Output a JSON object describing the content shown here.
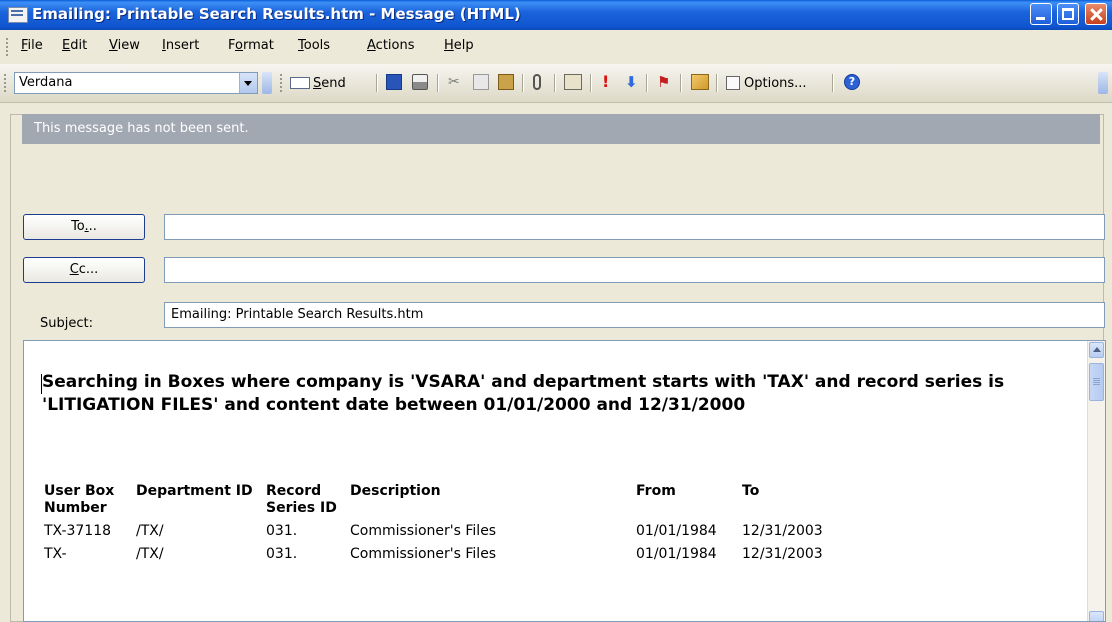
{
  "window": {
    "title": "Emailing: Printable Search Results.htm - Message (HTML)"
  },
  "menu": [
    {
      "label": "File",
      "ul": "F"
    },
    {
      "label": "Edit",
      "ul": "E"
    },
    {
      "label": "View",
      "ul": "V"
    },
    {
      "label": "Insert",
      "ul": "I"
    },
    {
      "label": "Format",
      "ul": "o"
    },
    {
      "label": "Tools",
      "ul": "T"
    },
    {
      "label": "Actions",
      "ul": "A"
    },
    {
      "label": "Help",
      "ul": "H"
    }
  ],
  "toolbar": {
    "font_name": "Verdana",
    "send_label": "Send",
    "options_label": "Options...",
    "icons": [
      "save-icon",
      "print-icon",
      "cut-icon",
      "copy-icon",
      "paste-icon",
      "attach-icon",
      "address-book-icon",
      "high-importance-icon",
      "low-importance-icon",
      "flag-icon",
      "permission-icon",
      "options-icon",
      "help-icon"
    ]
  },
  "message": {
    "status_banner": "This message has not been sent.",
    "to_button": "To...",
    "cc_button": "Cc...",
    "to_value": "",
    "cc_value": "",
    "subject_label": "Subject:",
    "subject_value": "Emailing: Printable Search Results.htm"
  },
  "body": {
    "heading": "Searching in Boxes where company is 'VSARA' and department starts with 'TAX' and record series is 'LITIGATION FILES' and content date between 01/01/2000 and 12/31/2000",
    "columns": [
      "User Box Number",
      "Department ID",
      "Record Series ID",
      "Description",
      "From",
      "To"
    ],
    "rows": [
      [
        "TX-37118",
        "/TX/",
        "031.",
        "Commissioner's Files",
        "01/01/1984",
        "12/31/2003"
      ],
      [
        "TX-",
        "/TX/",
        "031.",
        "Commissioner's Files",
        "01/01/1984",
        "12/31/2003"
      ]
    ]
  },
  "colors": {
    "titlebar": "#0f55cf",
    "banner": "#a1a8b2",
    "chrome": "#ece9d8"
  }
}
